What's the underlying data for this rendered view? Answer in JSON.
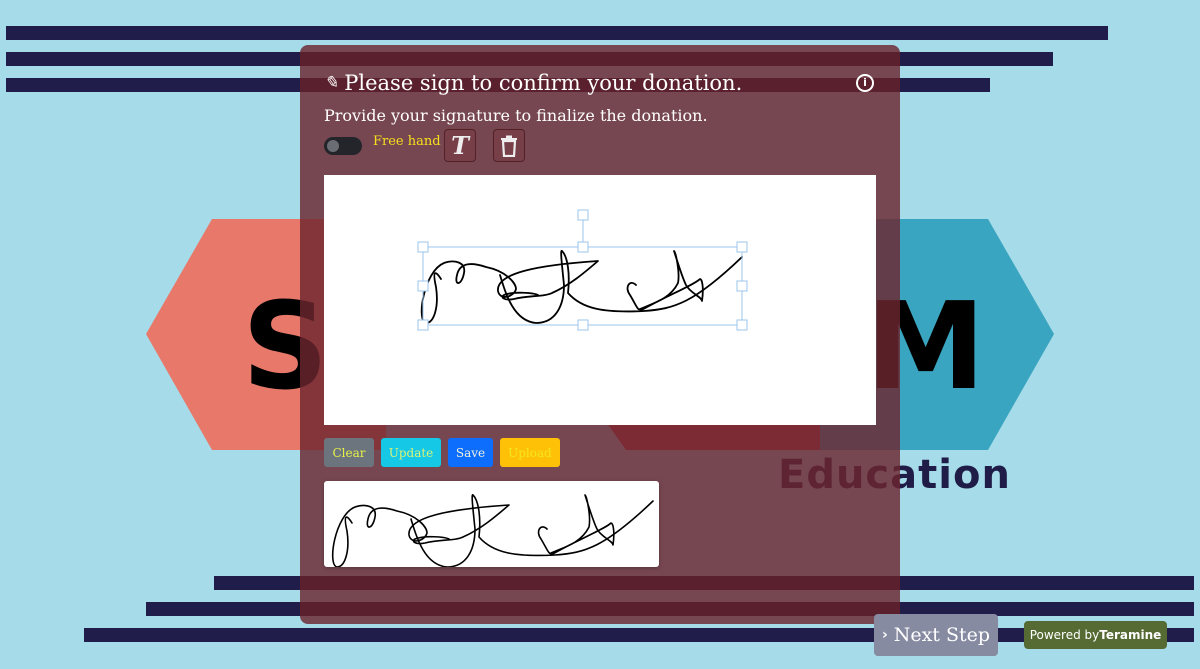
{
  "background": {
    "letters": [
      "S",
      "M"
    ],
    "tagline": "Education",
    "colors": {
      "page": "#a6dbe9",
      "stripe": "#201d4a",
      "hex_left": "#e8796a",
      "hex_middle": "#c0464f",
      "hex_right": "#3aa5c0"
    }
  },
  "modal": {
    "title_icon": "signature-icon",
    "title": "Please sign to confirm your donation.",
    "info_icon": "info-icon",
    "subtitle": "Provide your signature to finalize the donation.",
    "toolbar": {
      "toggle_on": false,
      "toggle_label": "Free hand",
      "text_tool_label": "T",
      "text_tool_icon": "text-icon",
      "delete_icon": "trash-icon"
    },
    "canvas": {
      "has_signature": true,
      "selection_handles": true
    },
    "buttons": {
      "clear": "Clear",
      "update": "Update",
      "save": "Save",
      "upload": "Upload"
    },
    "preview": {
      "has_signature": true
    }
  },
  "footer": {
    "next_step_icon": "chevron-right-icon",
    "next_step": "Next Step",
    "powered_prefix": "Powered by",
    "powered_brand": "Teramine",
    "powered_color": "#566b33"
  }
}
